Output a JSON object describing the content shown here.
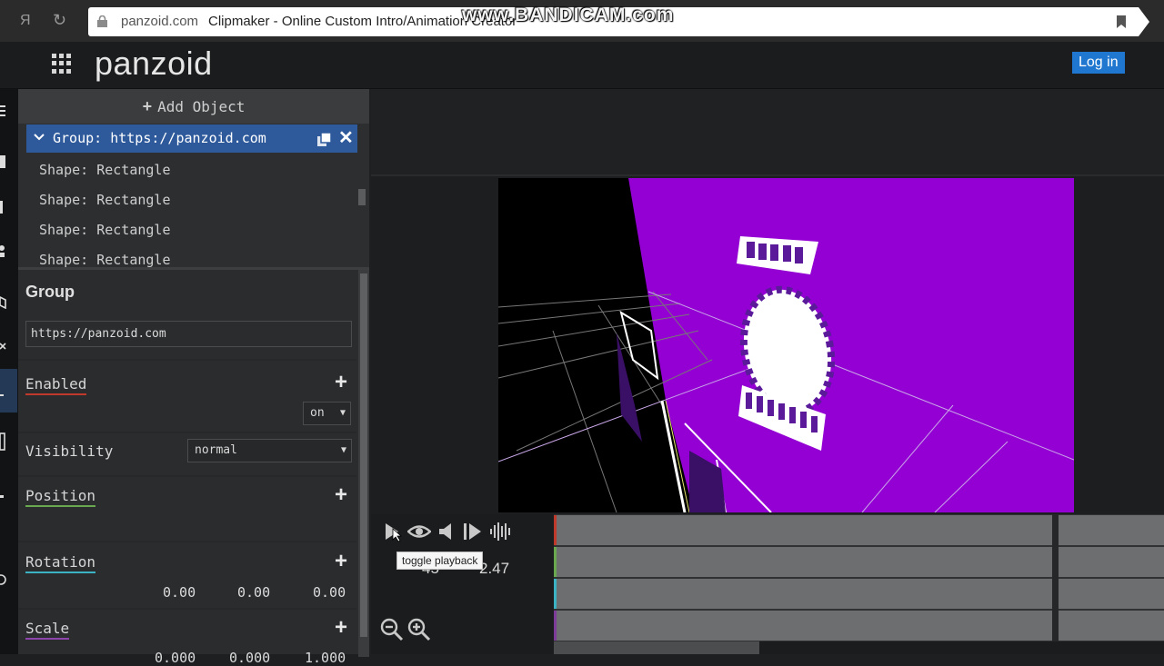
{
  "browser": {
    "back_glyph": "Я",
    "reload_glyph": "↻",
    "url_domain": "panzoid.com",
    "url_title": "Clipmaker - Online Custom Intro/Animation Creator",
    "watermark": "www.BANDICAM.com"
  },
  "header": {
    "logo": "panzoid",
    "login_label": "Log in",
    "accent": "#1f77d0"
  },
  "objects": {
    "add_label": "Add Object",
    "group_label": "Group: https://panzoid.com",
    "items": [
      "Shape: Rectangle",
      "Shape: Rectangle",
      "Shape: Rectangle",
      "Shape: Rectangle"
    ],
    "selected_color": "#2e5a9c"
  },
  "props": {
    "title": "Group",
    "name_value": "https://panzoid.com",
    "enabled_label": "Enabled",
    "enabled_value": "on",
    "visibility_label": "Visibility",
    "visibility_value": "normal",
    "position_label": "Position",
    "rotation_label": "Rotation",
    "rotation_values": [
      "0.00",
      "0.00",
      "0.00"
    ],
    "scale_label": "Scale",
    "scale_values": [
      "0.000",
      "0.000",
      "1.000"
    ],
    "underline_colors": {
      "enabled": "#c0392b",
      "position": "#6aa84f",
      "rotation": "#3bb3c3",
      "scale": "#8e44ad"
    }
  },
  "preview": {
    "background_color": "#9400d3"
  },
  "timeline": {
    "tooltip": "toggle playback",
    "time_left": "45",
    "time_right": "2.47",
    "track_colors": [
      "#c0392b",
      "#6aa84f",
      "#3bb3c3",
      "#7d3c98"
    ]
  }
}
